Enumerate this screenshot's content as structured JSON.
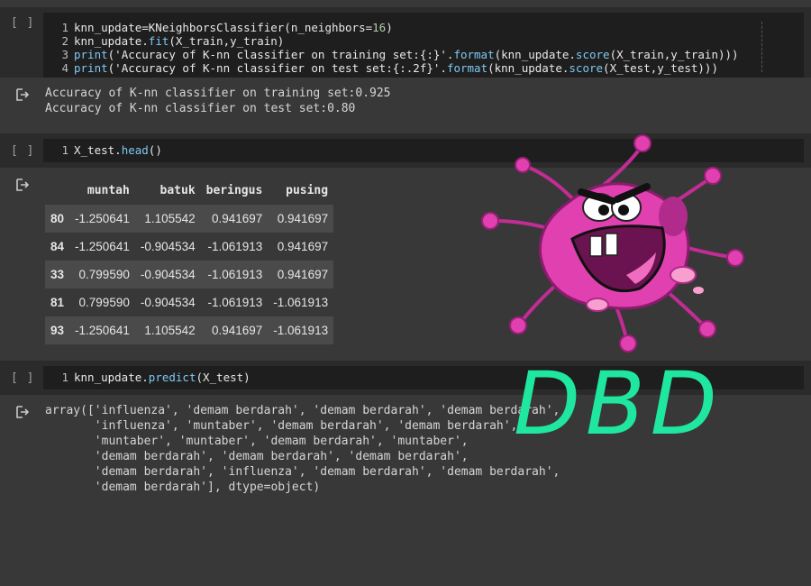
{
  "run_prompt": "[ ]",
  "cells": [
    {
      "lines": [
        {
          "n": "1",
          "parts": [
            {
              "t": "knn_update=KNeighborsClassifier(n_neighbors=",
              "c": "code"
            },
            {
              "t": "16",
              "c": "num"
            },
            {
              "t": ")",
              "c": "code"
            }
          ]
        },
        {
          "n": "2",
          "parts": [
            {
              "t": "knn_update.",
              "c": "code"
            },
            {
              "t": "fit",
              "c": "fn"
            },
            {
              "t": "(X_train,y_train)",
              "c": "code"
            }
          ]
        },
        {
          "n": "3",
          "parts": [
            {
              "t": "print",
              "c": "fn"
            },
            {
              "t": "('Accuracy of K-nn classifier on training set:{:}'.",
              "c": "str"
            },
            {
              "t": "format",
              "c": "fn"
            },
            {
              "t": "(knn_update.",
              "c": "code"
            },
            {
              "t": "score",
              "c": "fn"
            },
            {
              "t": "(X_train,y_train)))",
              "c": "code"
            }
          ]
        },
        {
          "n": "4",
          "parts": [
            {
              "t": "print",
              "c": "fn"
            },
            {
              "t": "('Accuracy of K-nn classifier on test set:{:.2f}'.",
              "c": "str"
            },
            {
              "t": "format",
              "c": "fn"
            },
            {
              "t": "(knn_update.",
              "c": "code"
            },
            {
              "t": "score",
              "c": "fn"
            },
            {
              "t": "(X_test,y_test)))",
              "c": "code"
            }
          ]
        }
      ],
      "output": "Accuracy of K-nn classifier on training set:0.925\nAccuracy of K-nn classifier on test set:0.80"
    },
    {
      "lines": [
        {
          "n": "1",
          "parts": [
            {
              "t": "X_test.",
              "c": "code"
            },
            {
              "t": "head",
              "c": "fn"
            },
            {
              "t": "()",
              "c": "code"
            }
          ]
        }
      ]
    },
    {
      "lines": [
        {
          "n": "1",
          "parts": [
            {
              "t": "knn_update.",
              "c": "code"
            },
            {
              "t": "predict",
              "c": "fn"
            },
            {
              "t": "(X_test)",
              "c": "code"
            }
          ]
        }
      ],
      "output": "array(['influenza', 'demam berdarah', 'demam berdarah', 'demam berdarah',\n       'influenza', 'muntaber', 'demam berdarah', 'demam berdarah',\n       'muntaber', 'muntaber', 'demam berdarah', 'muntaber',\n       'demam berdarah', 'demam berdarah', 'demam berdarah',\n       'demam berdarah', 'influenza', 'demam berdarah', 'demam berdarah',\n       'demam berdarah'], dtype=object)"
    }
  ],
  "dataframe": {
    "columns": [
      "",
      "muntah",
      "batuk",
      "beringus",
      "pusing"
    ],
    "rows": [
      [
        "80",
        "-1.250641",
        "1.105542",
        "0.941697",
        "0.941697"
      ],
      [
        "84",
        "-1.250641",
        "-0.904534",
        "-1.061913",
        "0.941697"
      ],
      [
        "33",
        "0.799590",
        "-0.904534",
        "-1.061913",
        "0.941697"
      ],
      [
        "81",
        "0.799590",
        "-0.904534",
        "-1.061913",
        "-1.061913"
      ],
      [
        "93",
        "-1.250641",
        "1.105542",
        "0.941697",
        "-1.061913"
      ]
    ]
  },
  "overlay_text": "DBD",
  "colors": {
    "accent_text": "#1fe7a0",
    "virus_body": "#e040b0",
    "function": "#7ec8f2"
  }
}
